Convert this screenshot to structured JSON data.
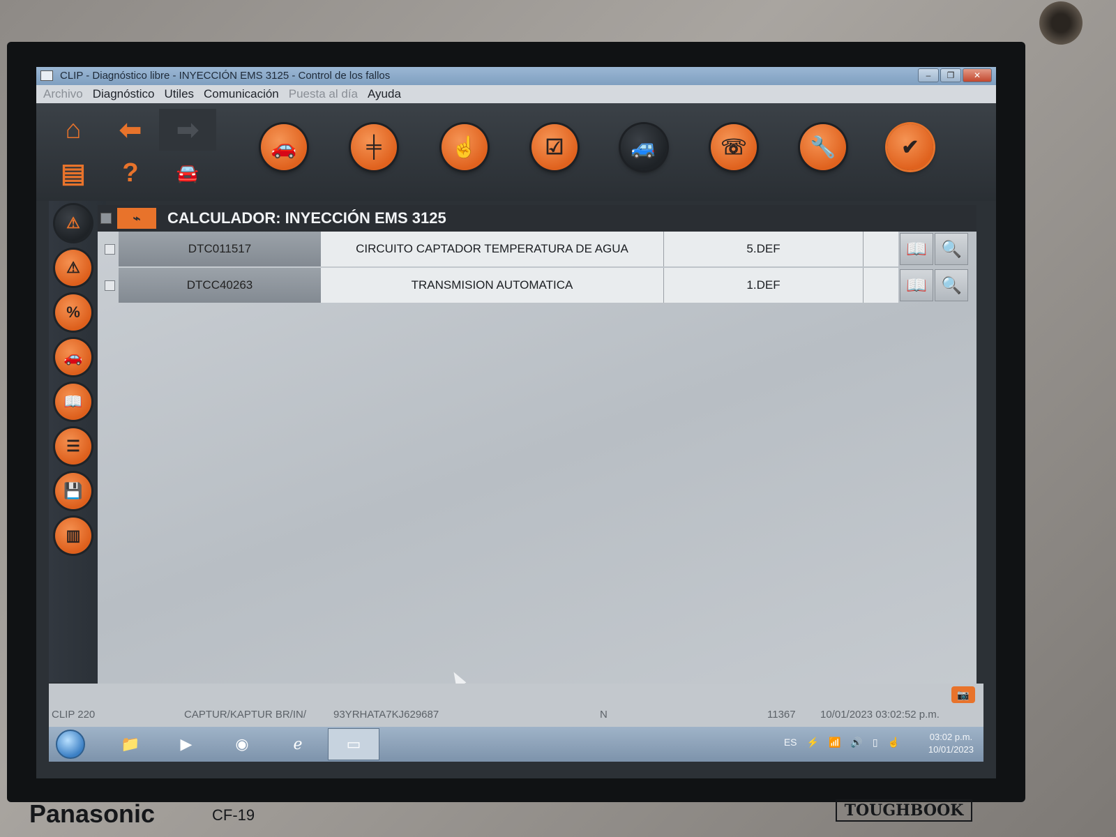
{
  "window": {
    "title": "CLIP - Diagnóstico libre - INYECCIÓN EMS 3125 - Control de los fallos",
    "buttons": {
      "minimize": "–",
      "restore": "❐",
      "close": "✕"
    }
  },
  "menu": {
    "items": [
      {
        "label": "Archivo",
        "dim": true
      },
      {
        "label": "Diagnóstico",
        "dim": false
      },
      {
        "label": "Utiles",
        "dim": false
      },
      {
        "label": "Comunicación",
        "dim": false
      },
      {
        "label": "Puesta al día",
        "dim": true
      },
      {
        "label": "Ayuda",
        "dim": false
      }
    ]
  },
  "toolbar": {
    "grid_icons": [
      "home-icon",
      "back-arrow-icon",
      "forward-arrow-icon",
      "printer-icon",
      "help-icon",
      "vehicle-info-icon"
    ],
    "round_icons": [
      "vehicle-identification-icon",
      "gearbox-icon",
      "touch-icon",
      "checklist-icon",
      "vehicle-scan-icon",
      "phone-support-icon",
      "wrench-icon",
      "vehicle-check-icon"
    ]
  },
  "sidebar": {
    "icons": [
      "warning-icon",
      "warning-icon",
      "percent-icon",
      "vehicle-icon",
      "manual-book-icon",
      "parameters-list-icon",
      "vehicle-save-icon",
      "barcode-icon"
    ]
  },
  "calculator": {
    "title": "CALCULADOR:  INYECCIÓN EMS 3125"
  },
  "dtcs": [
    {
      "code": "DTC011517",
      "description": "CIRCUITO CAPTADOR TEMPERATURA DE AGUA",
      "state": "5.DEF"
    },
    {
      "code": "DTCC40263",
      "description": "TRANSMISION AUTOMATICA",
      "state": "1.DEF"
    }
  ],
  "status": {
    "version": "CLIP 220",
    "vehicle": "CAPTUR/KAPTUR BR/IN/",
    "vin": "93YRHATA7KJ629687",
    "mode": "N",
    "number": "11367",
    "datetime": "10/01/2023 03:02:52 p.m."
  },
  "taskbar": {
    "language": "ES",
    "time": "03:02 p.m.",
    "date": "10/01/2023"
  },
  "device": {
    "brand": "Panasonic",
    "model": "CF-19",
    "series": "TOUGHBOOK"
  },
  "colors": {
    "accent": "#e8732b",
    "toolbar_bg": "#2c3136"
  }
}
